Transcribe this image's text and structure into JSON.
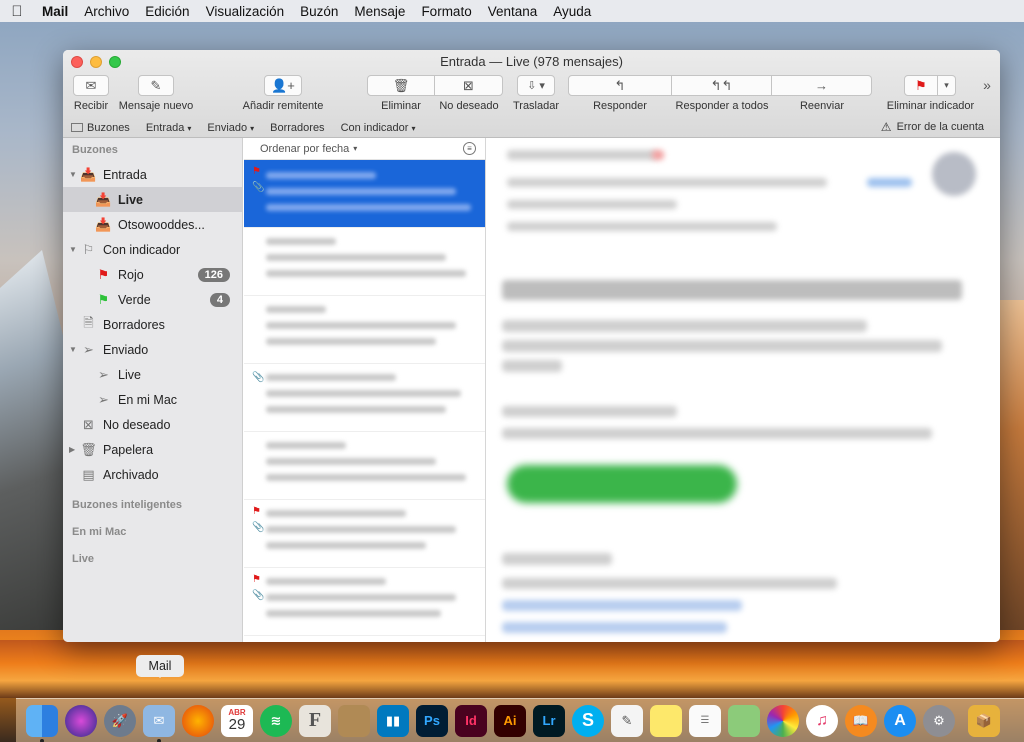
{
  "menubar": {
    "apple": "",
    "app": "Mail",
    "items": [
      "Archivo",
      "Edición",
      "Visualización",
      "Buzón",
      "Mensaje",
      "Formato",
      "Ventana",
      "Ayuda"
    ]
  },
  "window": {
    "title": "Entrada — Live (978 mensajes)"
  },
  "toolbar": {
    "recibir": "Recibir",
    "mensaje_nuevo": "Mensaje nuevo",
    "anadir_remitente": "Añadir remitente",
    "eliminar": "Eliminar",
    "no_deseado": "No deseado",
    "trasladar": "Trasladar",
    "responder": "Responder",
    "responder_todos": "Responder a todos",
    "reenviar": "Reenviar",
    "eliminar_indicador": "Eliminar indicador",
    "overflow": "»"
  },
  "favorites": {
    "buzones": "Buzones",
    "entrada": "Entrada",
    "enviado": "Enviado",
    "borradores": "Borradores",
    "con_indicador": "Con indicador",
    "error": "Error de la cuenta"
  },
  "sidebar": {
    "section_buzones": "Buzones",
    "entrada": "Entrada",
    "live": "Live",
    "otsowooddes": "Otsowooddes...",
    "con_indicador": "Con indicador",
    "rojo": "Rojo",
    "rojo_count": "126",
    "verde": "Verde",
    "verde_count": "4",
    "borradores": "Borradores",
    "enviado": "Enviado",
    "enviado_live": "Live",
    "en_mi_mac": "En mi Mac",
    "no_deseado": "No deseado",
    "papelera": "Papelera",
    "archivado": "Archivado",
    "section_inteligentes": "Buzones inteligentes",
    "section_mac": "En mi Mac",
    "section_live": "Live"
  },
  "list": {
    "sort_label": "Ordenar por fecha"
  },
  "dock": {
    "tooltip": "Mail",
    "calendar_month": "ABR",
    "calendar_day": "29",
    "apps": [
      "Finder",
      "Siri",
      "Launchpad",
      "Mail",
      "Firefox",
      "Calendario",
      "Spotify",
      "Font",
      "Notas",
      "Trello",
      "Ps",
      "Id",
      "Ai",
      "Lr",
      "Skype",
      "TextEdit",
      "Notas",
      "Recordatorios",
      "Mapas",
      "Fotos",
      "iTunes",
      "iBooks",
      "App Store",
      "Preferencias",
      "Archivo"
    ]
  },
  "colors": {
    "selection": "#1a66d9",
    "flag_red": "#e01a1a",
    "flag_green": "#2ec23a"
  }
}
